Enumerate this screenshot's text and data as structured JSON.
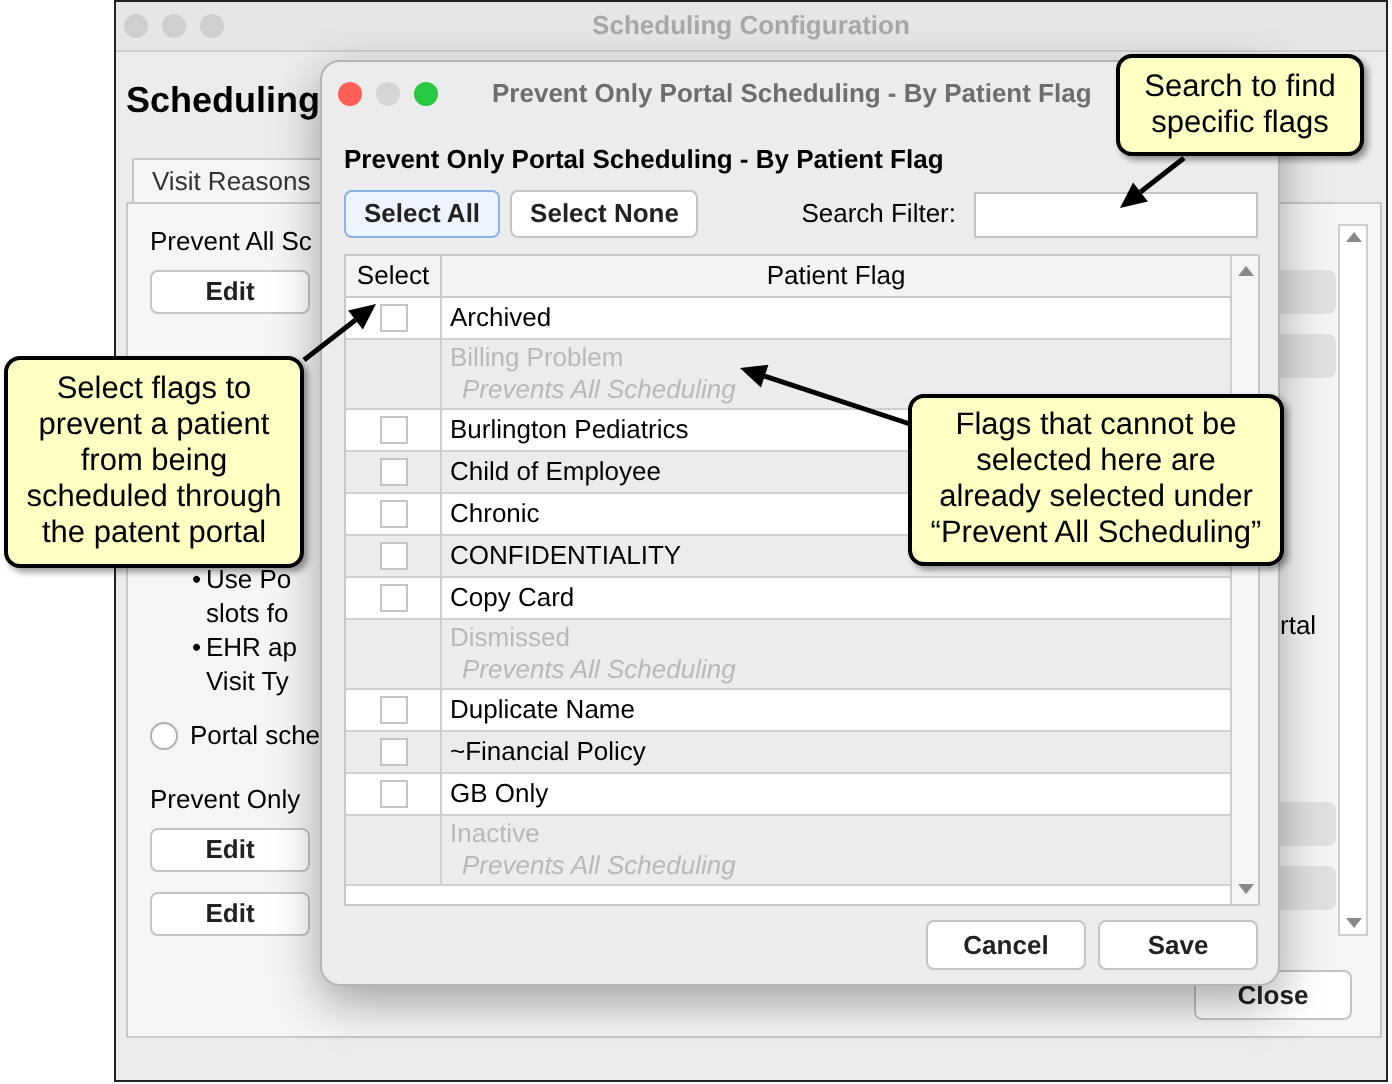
{
  "main_window": {
    "title": "Scheduling Configuration",
    "heading": "Scheduling",
    "tabs": [
      {
        "label": "Visit Reasons",
        "selected": true
      }
    ],
    "panel": [
      {
        "kind": "label",
        "text": "Prevent All Sc"
      },
      {
        "kind": "button",
        "text": "Edit"
      },
      {
        "kind": "gap"
      },
      {
        "kind": "bullet",
        "marker": "•",
        "lines": [
          "Use Po",
          "slots fo"
        ]
      },
      {
        "kind": "bullet",
        "marker": "•",
        "lines": [
          "EHR ap",
          "Visit Ty"
        ]
      },
      {
        "kind": "radio",
        "text": "Portal sche",
        "selected": false
      },
      {
        "kind": "label",
        "text": "Prevent Only"
      },
      {
        "kind": "button",
        "text": "Edit"
      },
      {
        "kind": "button",
        "text": "Edit"
      }
    ],
    "right_text": "rtal",
    "close_button": "Close"
  },
  "dialog": {
    "title": "Prevent Only Portal Scheduling - By Patient Flag",
    "heading": "Prevent Only Portal Scheduling - By Patient Flag",
    "buttons": [
      {
        "label": "Select All",
        "default": true
      },
      {
        "label": "Select None",
        "default": false
      }
    ],
    "search": {
      "label": "Search Filter:"
    },
    "table": {
      "columns": [
        "Select",
        "Patient Flag"
      ],
      "rows": [
        {
          "flag": "Archived",
          "disabled": false,
          "checked": false
        },
        {
          "flag": "Billing Problem",
          "disabled": true,
          "note": "Prevents All Scheduling"
        },
        {
          "flag": "Burlington Pediatrics",
          "disabled": false,
          "checked": false
        },
        {
          "flag": "Child of Employee",
          "disabled": false,
          "checked": false
        },
        {
          "flag": "Chronic",
          "disabled": false,
          "checked": false
        },
        {
          "flag": "CONFIDENTIALITY",
          "disabled": false,
          "checked": false
        },
        {
          "flag": "Copy Card",
          "disabled": false,
          "checked": false
        },
        {
          "flag": "Dismissed",
          "disabled": true,
          "note": "Prevents All Scheduling"
        },
        {
          "flag": "Duplicate Name",
          "disabled": false,
          "checked": false
        },
        {
          "flag": "~Financial Policy",
          "disabled": false,
          "checked": false
        },
        {
          "flag": "GB Only",
          "disabled": false,
          "checked": false
        },
        {
          "flag": "Inactive",
          "disabled": true,
          "note": "Prevents All Scheduling"
        }
      ]
    },
    "footer_buttons": [
      "Cancel",
      "Save"
    ]
  },
  "callouts": [
    {
      "text": "Search to find specific flags"
    },
    {
      "text": "Select flags to prevent a patient from being scheduled through the patent portal"
    },
    {
      "text": "Flags that cannot be selected here are already selected under “Prevent All Scheduling”"
    }
  ]
}
